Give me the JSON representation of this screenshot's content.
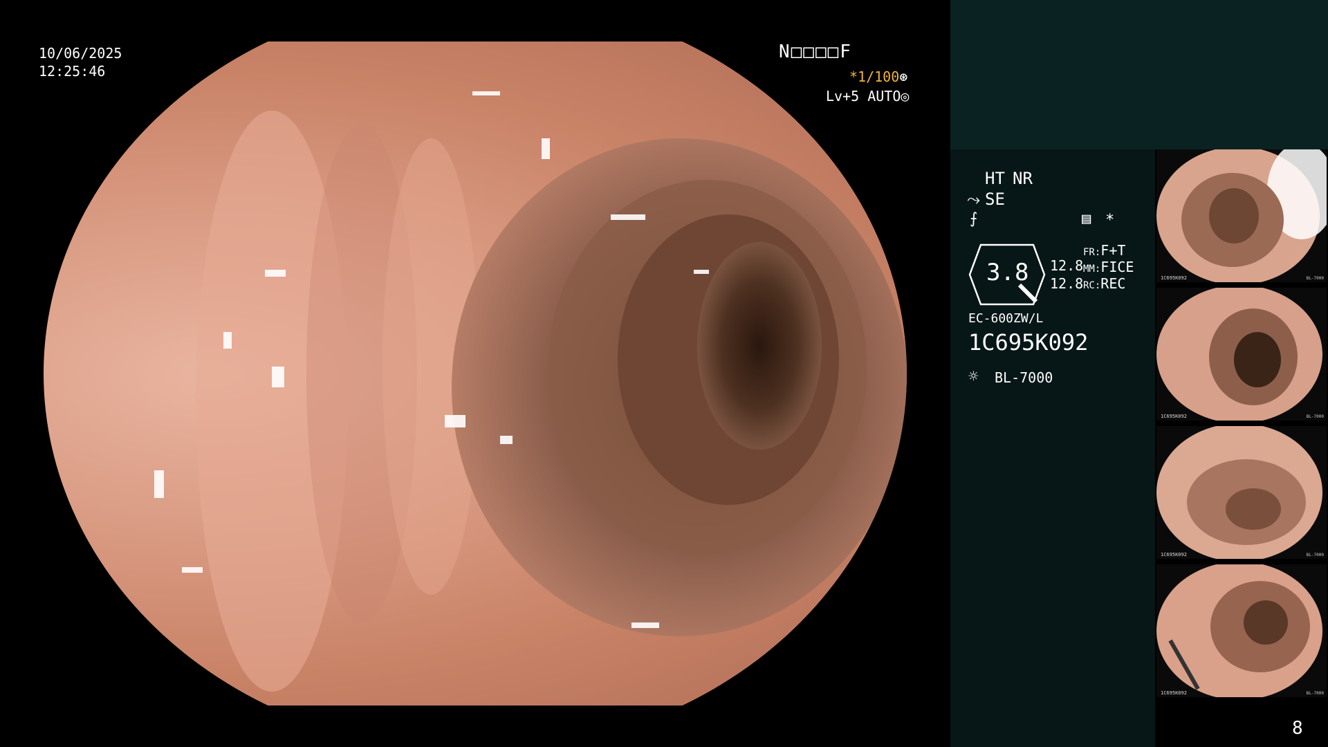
{
  "overlay": {
    "date": "10/06/2025",
    "time": "12:25:46",
    "patient_code": "N□□□□F",
    "shutter": "*1/100",
    "level": "Lv+5",
    "mode": "AUTO"
  },
  "panel": {
    "ht": "HT",
    "nr": "NR",
    "se": "SE",
    "zoom_value": "3.8",
    "scale_a": "12.8",
    "scale_b": "12.8",
    "fr_key": "FR:",
    "fr_val": "F+T",
    "mm_key": "MM:",
    "mm_val": "FICE",
    "rc_key": "RC:",
    "rc_val": "REC",
    "scope_model": "EC-600ZW/L",
    "scope_serial": "1C695K092",
    "light_source": "BL-7000",
    "page_number": "8"
  },
  "thumbnails": [
    {
      "caption": "1C695K092",
      "meta": "BL-7000"
    },
    {
      "caption": "1C695K092",
      "meta": "BL-7000"
    },
    {
      "caption": "1C695K092",
      "meta": "BL-7000"
    },
    {
      "caption": "1C695K092",
      "meta": "BL-7000"
    }
  ],
  "colors": {
    "accent_yellow": "#f2b437",
    "panel_top": "#0b2222",
    "panel_info": "#071616",
    "tissue": "#d99a82"
  }
}
